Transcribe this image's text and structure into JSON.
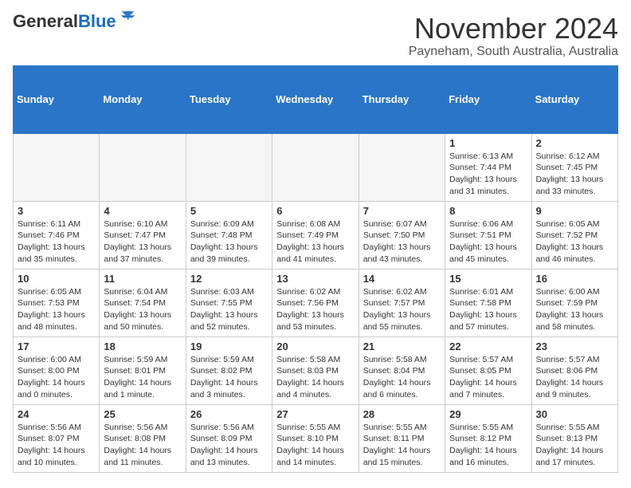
{
  "header": {
    "logo_general": "General",
    "logo_blue": "Blue",
    "month_title": "November 2024",
    "location": "Payneham, South Australia, Australia"
  },
  "days_of_week": [
    "Sunday",
    "Monday",
    "Tuesday",
    "Wednesday",
    "Thursday",
    "Friday",
    "Saturday"
  ],
  "weeks": [
    [
      {
        "day": "",
        "info": ""
      },
      {
        "day": "",
        "info": ""
      },
      {
        "day": "",
        "info": ""
      },
      {
        "day": "",
        "info": ""
      },
      {
        "day": "",
        "info": ""
      },
      {
        "day": "1",
        "info": "Sunrise: 6:13 AM\nSunset: 7:44 PM\nDaylight: 13 hours\nand 31 minutes."
      },
      {
        "day": "2",
        "info": "Sunrise: 6:12 AM\nSunset: 7:45 PM\nDaylight: 13 hours\nand 33 minutes."
      }
    ],
    [
      {
        "day": "3",
        "info": "Sunrise: 6:11 AM\nSunset: 7:46 PM\nDaylight: 13 hours\nand 35 minutes."
      },
      {
        "day": "4",
        "info": "Sunrise: 6:10 AM\nSunset: 7:47 PM\nDaylight: 13 hours\nand 37 minutes."
      },
      {
        "day": "5",
        "info": "Sunrise: 6:09 AM\nSunset: 7:48 PM\nDaylight: 13 hours\nand 39 minutes."
      },
      {
        "day": "6",
        "info": "Sunrise: 6:08 AM\nSunset: 7:49 PM\nDaylight: 13 hours\nand 41 minutes."
      },
      {
        "day": "7",
        "info": "Sunrise: 6:07 AM\nSunset: 7:50 PM\nDaylight: 13 hours\nand 43 minutes."
      },
      {
        "day": "8",
        "info": "Sunrise: 6:06 AM\nSunset: 7:51 PM\nDaylight: 13 hours\nand 45 minutes."
      },
      {
        "day": "9",
        "info": "Sunrise: 6:05 AM\nSunset: 7:52 PM\nDaylight: 13 hours\nand 46 minutes."
      }
    ],
    [
      {
        "day": "10",
        "info": "Sunrise: 6:05 AM\nSunset: 7:53 PM\nDaylight: 13 hours\nand 48 minutes."
      },
      {
        "day": "11",
        "info": "Sunrise: 6:04 AM\nSunset: 7:54 PM\nDaylight: 13 hours\nand 50 minutes."
      },
      {
        "day": "12",
        "info": "Sunrise: 6:03 AM\nSunset: 7:55 PM\nDaylight: 13 hours\nand 52 minutes."
      },
      {
        "day": "13",
        "info": "Sunrise: 6:02 AM\nSunset: 7:56 PM\nDaylight: 13 hours\nand 53 minutes."
      },
      {
        "day": "14",
        "info": "Sunrise: 6:02 AM\nSunset: 7:57 PM\nDaylight: 13 hours\nand 55 minutes."
      },
      {
        "day": "15",
        "info": "Sunrise: 6:01 AM\nSunset: 7:58 PM\nDaylight: 13 hours\nand 57 minutes."
      },
      {
        "day": "16",
        "info": "Sunrise: 6:00 AM\nSunset: 7:59 PM\nDaylight: 13 hours\nand 58 minutes."
      }
    ],
    [
      {
        "day": "17",
        "info": "Sunrise: 6:00 AM\nSunset: 8:00 PM\nDaylight: 14 hours\nand 0 minutes."
      },
      {
        "day": "18",
        "info": "Sunrise: 5:59 AM\nSunset: 8:01 PM\nDaylight: 14 hours\nand 1 minute."
      },
      {
        "day": "19",
        "info": "Sunrise: 5:59 AM\nSunset: 8:02 PM\nDaylight: 14 hours\nand 3 minutes."
      },
      {
        "day": "20",
        "info": "Sunrise: 5:58 AM\nSunset: 8:03 PM\nDaylight: 14 hours\nand 4 minutes."
      },
      {
        "day": "21",
        "info": "Sunrise: 5:58 AM\nSunset: 8:04 PM\nDaylight: 14 hours\nand 6 minutes."
      },
      {
        "day": "22",
        "info": "Sunrise: 5:57 AM\nSunset: 8:05 PM\nDaylight: 14 hours\nand 7 minutes."
      },
      {
        "day": "23",
        "info": "Sunrise: 5:57 AM\nSunset: 8:06 PM\nDaylight: 14 hours\nand 9 minutes."
      }
    ],
    [
      {
        "day": "24",
        "info": "Sunrise: 5:56 AM\nSunset: 8:07 PM\nDaylight: 14 hours\nand 10 minutes."
      },
      {
        "day": "25",
        "info": "Sunrise: 5:56 AM\nSunset: 8:08 PM\nDaylight: 14 hours\nand 11 minutes."
      },
      {
        "day": "26",
        "info": "Sunrise: 5:56 AM\nSunset: 8:09 PM\nDaylight: 14 hours\nand 13 minutes."
      },
      {
        "day": "27",
        "info": "Sunrise: 5:55 AM\nSunset: 8:10 PM\nDaylight: 14 hours\nand 14 minutes."
      },
      {
        "day": "28",
        "info": "Sunrise: 5:55 AM\nSunset: 8:11 PM\nDaylight: 14 hours\nand 15 minutes."
      },
      {
        "day": "29",
        "info": "Sunrise: 5:55 AM\nSunset: 8:12 PM\nDaylight: 14 hours\nand 16 minutes."
      },
      {
        "day": "30",
        "info": "Sunrise: 5:55 AM\nSunset: 8:13 PM\nDaylight: 14 hours\nand 17 minutes."
      }
    ]
  ]
}
